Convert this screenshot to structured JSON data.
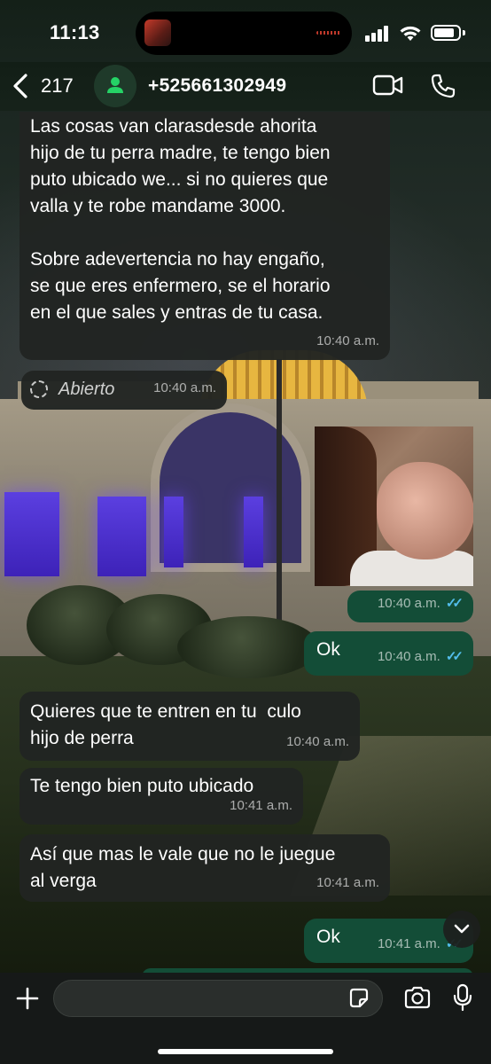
{
  "status_bar": {
    "time": "11:13",
    "battery_level": 0.85,
    "signal_bars": 4
  },
  "header": {
    "back_count": "217",
    "contact": "+525661302949",
    "icons": [
      "chevron-left-icon",
      "person-icon",
      "video-camera-icon",
      "phone-icon"
    ]
  },
  "messages": [
    {
      "id": "m1",
      "direction": "incoming",
      "text": "Las cosas van clarasdesde ahorita\nhijo de tu perra madre, te tengo bien\nputo ubicado we... si no quieres que\nvalla y te robe mandame 3000.\n\nSobre adevertencia no hay engaño,\nse que eres enfermero, se el horario\nen el que sales y entras de tu casa.",
      "time": "10:40 a.m."
    },
    {
      "id": "m2",
      "direction": "incoming",
      "type": "view-once",
      "text": "Abierto",
      "time": "10:40 a.m."
    },
    {
      "id": "m3",
      "direction": "outgoing",
      "type": "photo",
      "time": "10:40 a.m.",
      "status": "read"
    },
    {
      "id": "m4",
      "direction": "outgoing",
      "text": "Ok",
      "time": "10:40 a.m.",
      "status": "read"
    },
    {
      "id": "m5",
      "direction": "incoming",
      "text": "Quieres que te entren en tu  culo\nhijo de perra",
      "time": "10:40 a.m."
    },
    {
      "id": "m6",
      "direction": "incoming",
      "text": "Te tengo bien puto ubicado",
      "time": "10:41 a.m."
    },
    {
      "id": "m7",
      "direction": "incoming",
      "text": "Así que mas le vale que no le juegue\nal verga",
      "time": "10:41 a.m."
    },
    {
      "id": "m8",
      "direction": "outgoing",
      "text": "Ok",
      "time": "10:41 a.m.",
      "status": "read"
    }
  ],
  "input": {
    "placeholder": ""
  },
  "colors": {
    "outgoing_bubble": "#134d37",
    "incoming_bubble": "#212422",
    "read_ticks": "#53bdeb"
  }
}
